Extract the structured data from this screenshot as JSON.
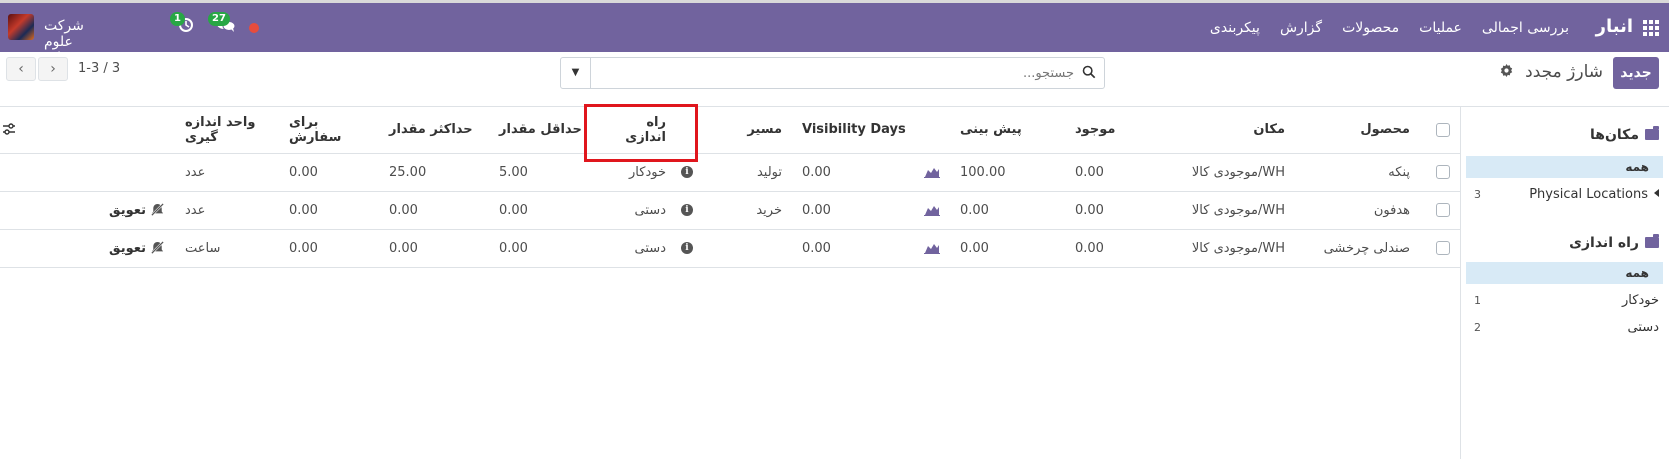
{
  "nav": {
    "brand": "انبار",
    "menu": [
      "بررسی اجمالی",
      "عملیات",
      "محصولات",
      "گزارش",
      "پیکربندی"
    ],
    "company": "شرکت علوم تحقیقات",
    "activity_count": "1",
    "messages_count": "27"
  },
  "control_panel": {
    "new_button": "جدید",
    "title": "شارژ مجدد",
    "search_placeholder": "جستجو...",
    "pager_value": "1-3 / 3"
  },
  "sidebar": {
    "locations": {
      "header": "مکان‌ها",
      "all_label": "همه",
      "items": [
        {
          "label": "Physical Locations",
          "count": "3"
        }
      ]
    },
    "trigger": {
      "header": "راه اندازی",
      "all_label": "همه",
      "items": [
        {
          "label": "خودکار",
          "count": "1"
        },
        {
          "label": "دستی",
          "count": "2"
        }
      ]
    }
  },
  "table": {
    "columns": {
      "product": "محصول",
      "location": "مکان",
      "on_hand": "موجود",
      "forecast": "پیش بینی",
      "visibility_days": "Visibility Days",
      "route": "مسیر",
      "trigger": "راه اندازی",
      "min_qty": "حداقل مقدار",
      "max_qty": "حداکثر مقدار",
      "to_order": "برای سفارش",
      "uom": "واحد اندازه گیری"
    },
    "rows": [
      {
        "product": "پنکه",
        "location": "WH/موجودی کالا",
        "on_hand": "0.00",
        "forecast": "100.00",
        "visibility_days": "0.00",
        "route": "تولید",
        "trigger": "خودکار",
        "min_qty": "5.00",
        "max_qty": "25.00",
        "to_order": "0.00",
        "uom": "عدد",
        "action": ""
      },
      {
        "product": "هدفون",
        "location": "WH/موجودی کالا",
        "on_hand": "0.00",
        "forecast": "0.00",
        "visibility_days": "0.00",
        "route": "خرید",
        "trigger": "دستی",
        "min_qty": "0.00",
        "max_qty": "0.00",
        "to_order": "0.00",
        "uom": "عدد",
        "action": "تعویق"
      },
      {
        "product": "صندلی چرخشی",
        "location": "WH/موجودی کالا",
        "on_hand": "0.00",
        "forecast": "0.00",
        "visibility_days": "0.00",
        "route": "",
        "trigger": "دستی",
        "min_qty": "0.00",
        "max_qty": "0.00",
        "to_order": "0.00",
        "uom": "ساعت",
        "action": "تعویق"
      }
    ]
  },
  "colors": {
    "brand": "#71639e",
    "highlight": "#e0161d",
    "selected_filter": "#d8eaf6"
  }
}
